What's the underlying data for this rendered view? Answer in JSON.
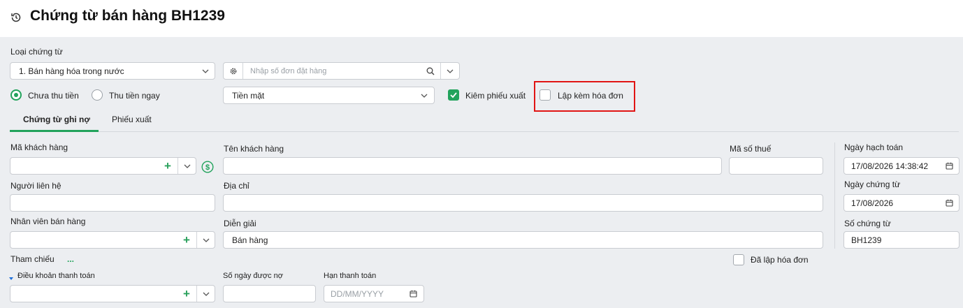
{
  "header": {
    "title": "Chứng từ bán hàng BH1239",
    "history_icon": "history-icon"
  },
  "voucher_type": {
    "label": "Loại chứng từ",
    "value": "1. Bán hàng hóa trong nước"
  },
  "order_search": {
    "placeholder": "Nhập số đơn đặt hàng"
  },
  "payment": {
    "unpaid_label": "Chưa thu tiền",
    "paid_label": "Thu tiền ngay",
    "selected": "Chưa thu tiền",
    "method_value": "Tiền mặt"
  },
  "options": {
    "delivery_note_label": "Kiêm phiếu xuất",
    "delivery_note_checked": true,
    "with_invoice_label": "Lập kèm hóa đơn",
    "with_invoice_checked": false,
    "highlight_color": "#e11414"
  },
  "tabs": [
    {
      "label": "Chứng từ ghi nợ",
      "active": true
    },
    {
      "label": "Phiếu xuất",
      "active": false
    }
  ],
  "form": {
    "customer_code_label": "Mã khách hàng",
    "customer_name_label": "Tên khách hàng",
    "tax_code_label": "Mã số thuế",
    "contact_label": "Người liên hệ",
    "address_label": "Địa chỉ",
    "sales_staff_label": "Nhân viên bán hàng",
    "description_label": "Diễn giải",
    "description_value": "Bán hàng",
    "reference_label": "Tham chiếu",
    "reference_more": "...",
    "invoiced_label": "Đã lập hóa đơn",
    "payment_terms_label": "Điều khoản thanh toán",
    "credit_days_label": "Số ngày được nợ",
    "due_date_label": "Hạn thanh toán",
    "due_date_placeholder": "DD/MM/YYYY"
  },
  "side": {
    "posting_date_label": "Ngày hạch toán",
    "posting_date_value": "17/08/2026 14:38:42",
    "voucher_date_label": "Ngày chứng từ",
    "voucher_date_value": "17/08/2026",
    "voucher_no_label": "Số chứng từ",
    "voucher_no_value": "BH1239"
  },
  "colors": {
    "accent": "#22a35c",
    "background": "#eceef1"
  }
}
